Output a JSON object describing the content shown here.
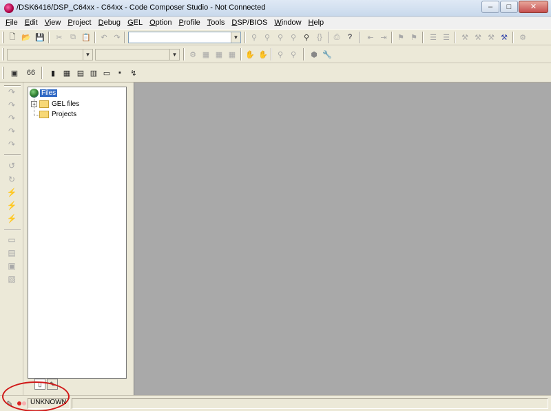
{
  "window": {
    "title": "/DSK6416/DSP_C64xx - C64xx - Code Composer Studio - Not Connected",
    "minimize_glyph": "–",
    "maximize_glyph": "□",
    "close_glyph": "✕"
  },
  "menu": {
    "items": [
      {
        "accel": "F",
        "rest": "ile"
      },
      {
        "accel": "E",
        "rest": "dit"
      },
      {
        "accel": "V",
        "rest": "iew"
      },
      {
        "accel": "P",
        "rest": "roject"
      },
      {
        "accel": "D",
        "rest": "ebug"
      },
      {
        "accel": "G",
        "rest": "EL"
      },
      {
        "accel": "O",
        "rest": "ption"
      },
      {
        "accel": "P",
        "rest": "rofile"
      },
      {
        "accel": "T",
        "rest": "ools"
      },
      {
        "accel": "D",
        "rest": "SP/BIOS"
      },
      {
        "accel": "W",
        "rest": "indow"
      },
      {
        "accel": "H",
        "rest": "elp"
      }
    ]
  },
  "toolbar": {
    "search_combo_value": "",
    "project_combo_value": "",
    "config_combo_value": ""
  },
  "project_tree": {
    "root_label": "Files",
    "expander_glyph": "+",
    "nodes": [
      {
        "label": "GEL files"
      },
      {
        "label": "Projects"
      }
    ]
  },
  "statusbar": {
    "status_text": "UNKNOWN"
  },
  "colors": {
    "selection": "#316ac5",
    "workspace": "#a9a9a9",
    "annotation": "#d01818"
  }
}
